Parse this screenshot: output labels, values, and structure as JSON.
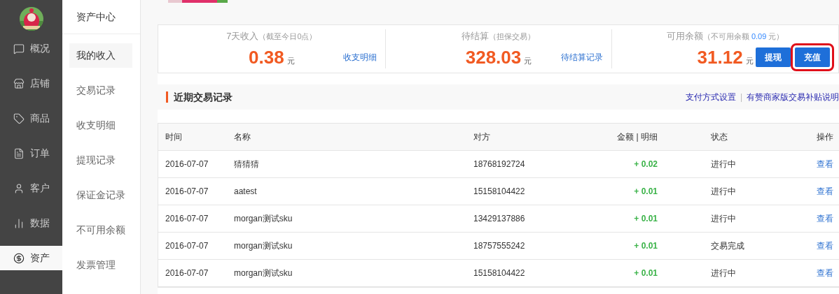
{
  "nav": {
    "items": [
      {
        "label": "概况",
        "selected": false
      },
      {
        "label": "店铺",
        "selected": false
      },
      {
        "label": "商品",
        "selected": false
      },
      {
        "label": "订单",
        "selected": false
      },
      {
        "label": "客户",
        "selected": false
      },
      {
        "label": "数据",
        "selected": false
      },
      {
        "label": "资产",
        "selected": true
      }
    ]
  },
  "subnav": {
    "title": "资产中心",
    "items": [
      {
        "label": "我的收入",
        "selected": true
      },
      {
        "label": "交易记录",
        "selected": false
      },
      {
        "label": "收支明细",
        "selected": false
      },
      {
        "label": "提现记录",
        "selected": false
      },
      {
        "label": "保证金记录",
        "selected": false
      },
      {
        "label": "不可用余额",
        "selected": false
      },
      {
        "label": "发票管理",
        "selected": false
      }
    ]
  },
  "stats": [
    {
      "label": "7天收入",
      "note": "（截至今日0点）",
      "value": "0.38",
      "unit": "元",
      "link": "收支明细"
    },
    {
      "label": "待结算",
      "note": "（担保交易）",
      "value": "328.03",
      "unit": "元",
      "link": "待结算记录"
    },
    {
      "label": "可用余额",
      "note": "（不可用余额",
      "note_amount": "0.09",
      "note_suffix": "元）",
      "value": "31.12",
      "unit": "元",
      "buttons": [
        {
          "label": "提现",
          "highlighted": false
        },
        {
          "label": "充值",
          "highlighted": true
        }
      ]
    }
  ],
  "section": {
    "title": "近期交易记录",
    "links": [
      "支付方式设置",
      "有赞商家版交易补贴说明"
    ],
    "separator": "|"
  },
  "table": {
    "columns": [
      "时间",
      "名称",
      "对方",
      "金额 | 明细",
      "状态",
      "操作"
    ],
    "rows": [
      {
        "time": "2016-07-07",
        "name": "猜猜猜",
        "party": "18768192724",
        "amount": "+ 0.02",
        "status": "进行中",
        "action": "查看"
      },
      {
        "time": "2016-07-07",
        "name": "aatest",
        "party": "15158104422",
        "amount": "+ 0.01",
        "status": "进行中",
        "action": "查看"
      },
      {
        "time": "2016-07-07",
        "name": "morgan测试sku",
        "party": "13429137886",
        "amount": "+ 0.01",
        "status": "进行中",
        "action": "查看"
      },
      {
        "time": "2016-07-07",
        "name": "morgan测试sku",
        "party": "18757555242",
        "amount": "+ 0.01",
        "status": "交易完成",
        "action": "查看"
      },
      {
        "time": "2016-07-07",
        "name": "morgan测试sku",
        "party": "15158104422",
        "amount": "+ 0.01",
        "status": "进行中",
        "action": "查看"
      }
    ]
  }
}
